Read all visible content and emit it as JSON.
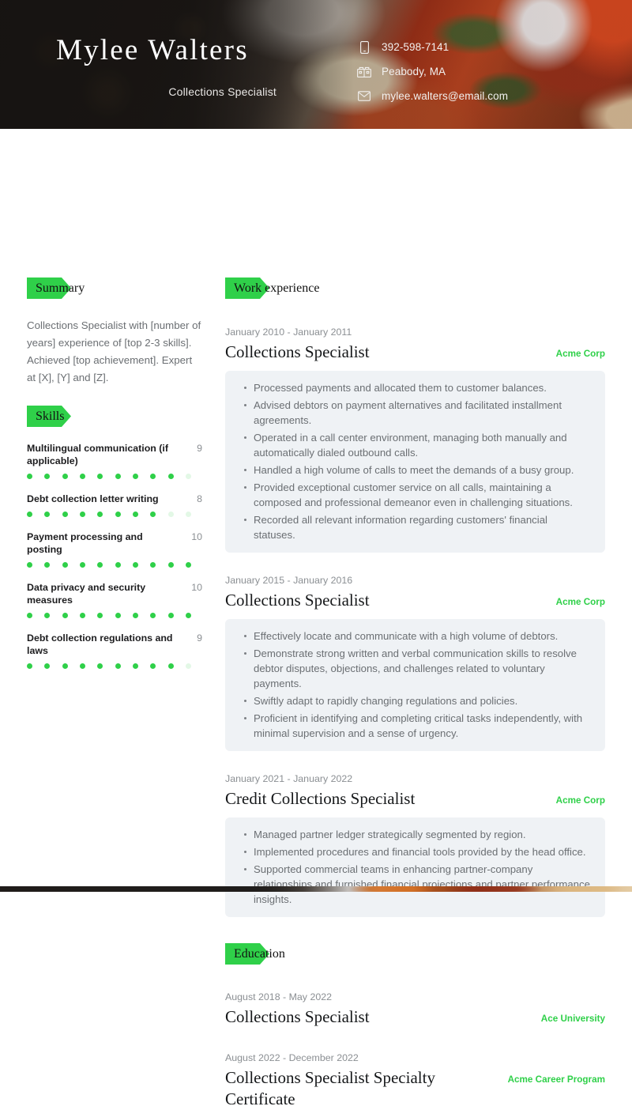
{
  "theme": {
    "accent_green": "#2fd049",
    "bullet_card_bg": "#eff2f5",
    "muted_text": "#6b6f73"
  },
  "header": {
    "name": "Mylee Walters",
    "job_title": "Collections Specialist",
    "contacts": [
      {
        "icon": "phone-icon",
        "value": "392-598-7141"
      },
      {
        "icon": "building-icon",
        "value": "Peabody, MA"
      },
      {
        "icon": "envelope-icon",
        "value": "mylee.walters@email.com"
      }
    ]
  },
  "sidebar": {
    "summary": {
      "heading": "Summary",
      "text": "Collections Specialist with [number of years] experience of [top 2-3 skills]. Achieved [top achievement]. Expert at [X], [Y] and [Z]."
    },
    "skills": {
      "heading": "Skills",
      "max": 10,
      "items": [
        {
          "name": "Multilingual communication (if applicable)",
          "score": 9
        },
        {
          "name": "Debt collection letter writing",
          "score": 8
        },
        {
          "name": "Payment processing and posting",
          "score": 10
        },
        {
          "name": "Data privacy and security measures",
          "score": 10
        },
        {
          "name": "Debt collection regulations and laws",
          "score": 9
        }
      ]
    }
  },
  "main": {
    "work_experience": {
      "heading": "Work experience",
      "entries": [
        {
          "dates": "January 2010 - January 2011",
          "title": "Collections Specialist",
          "org": "Acme Corp",
          "bullets": [
            "Processed payments and allocated them to customer balances.",
            "Advised debtors on payment alternatives and facilitated installment agreements.",
            "Operated in a call center environment, managing both manually and automatically dialed outbound calls.",
            "Handled a high volume of calls to meet the demands of a busy group.",
            "Provided exceptional customer service on all calls, maintaining a composed and professional demeanor even in challenging situations.",
            "Recorded all relevant information regarding customers' financial statuses."
          ]
        },
        {
          "dates": "January 2015 - January 2016",
          "title": "Collections Specialist",
          "org": "Acme Corp",
          "bullets": [
            "Effectively locate and communicate with a high volume of debtors.",
            "Demonstrate strong written and verbal communication skills to resolve debtor disputes, objections, and challenges related to voluntary payments.",
            "Swiftly adapt to rapidly changing regulations and policies.",
            "Proficient in identifying and completing critical tasks independently, with minimal supervision and a sense of urgency."
          ]
        },
        {
          "dates": "January 2021 - January 2022",
          "title": "Credit Collections Specialist",
          "org": "Acme Corp",
          "bullets": [
            "Managed partner ledger strategically segmented by region.",
            "Implemented procedures and financial tools provided by the head office.",
            "Supported commercial teams in enhancing partner-company relationships and furnished financial projections and partner performance insights."
          ]
        }
      ]
    },
    "education": {
      "heading": "Education",
      "entries": [
        {
          "dates": "August 2018 - May 2022",
          "title": "Collections Specialist",
          "org": "Ace University"
        },
        {
          "dates": "August 2022 - December 2022",
          "title": "Collections Specialist Specialty Certificate",
          "org": "Acme Career Program"
        }
      ]
    }
  }
}
